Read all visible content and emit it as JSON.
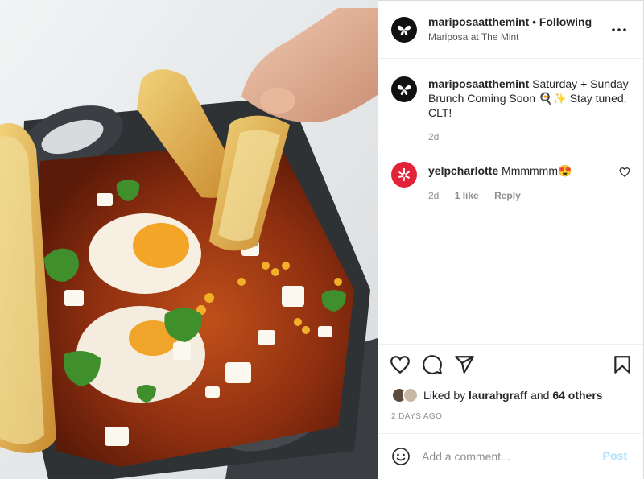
{
  "post": {
    "username": "mariposaatthemint",
    "separator": "•",
    "follow_status": "Following",
    "location": "Mariposa at The Mint",
    "caption_username": "mariposaatthemint",
    "caption_text": "Saturday + Sunday Brunch Coming Soon 🍳✨ Stay tuned, CLT!",
    "caption_time": "2d"
  },
  "comments": [
    {
      "username": "yelpcharlotte",
      "text": "Mmmmmm😍",
      "time": "2d",
      "likes": "1 like",
      "reply_label": "Reply"
    }
  ],
  "likes": {
    "prefix": "Liked by",
    "liker": "laurahgraff",
    "conjunction": "and",
    "others": "64 others"
  },
  "date_label": "2 DAYS AGO",
  "comment_box": {
    "placeholder": "Add a comment...",
    "post_label": "Post"
  },
  "icons": {
    "header": [
      "butterfly-avatar-icon",
      "more-options-icon"
    ],
    "actions": [
      "heart-icon",
      "comment-icon",
      "share-icon",
      "bookmark-icon"
    ],
    "comment": [
      "yelp-icon",
      "small-heart-icon",
      "emoji-icon"
    ]
  },
  "colors": {
    "link_blue_disabled": "#b2dffc",
    "yelp_red": "#e2243a",
    "text_primary": "#262626",
    "text_secondary": "#8e8e8e"
  }
}
